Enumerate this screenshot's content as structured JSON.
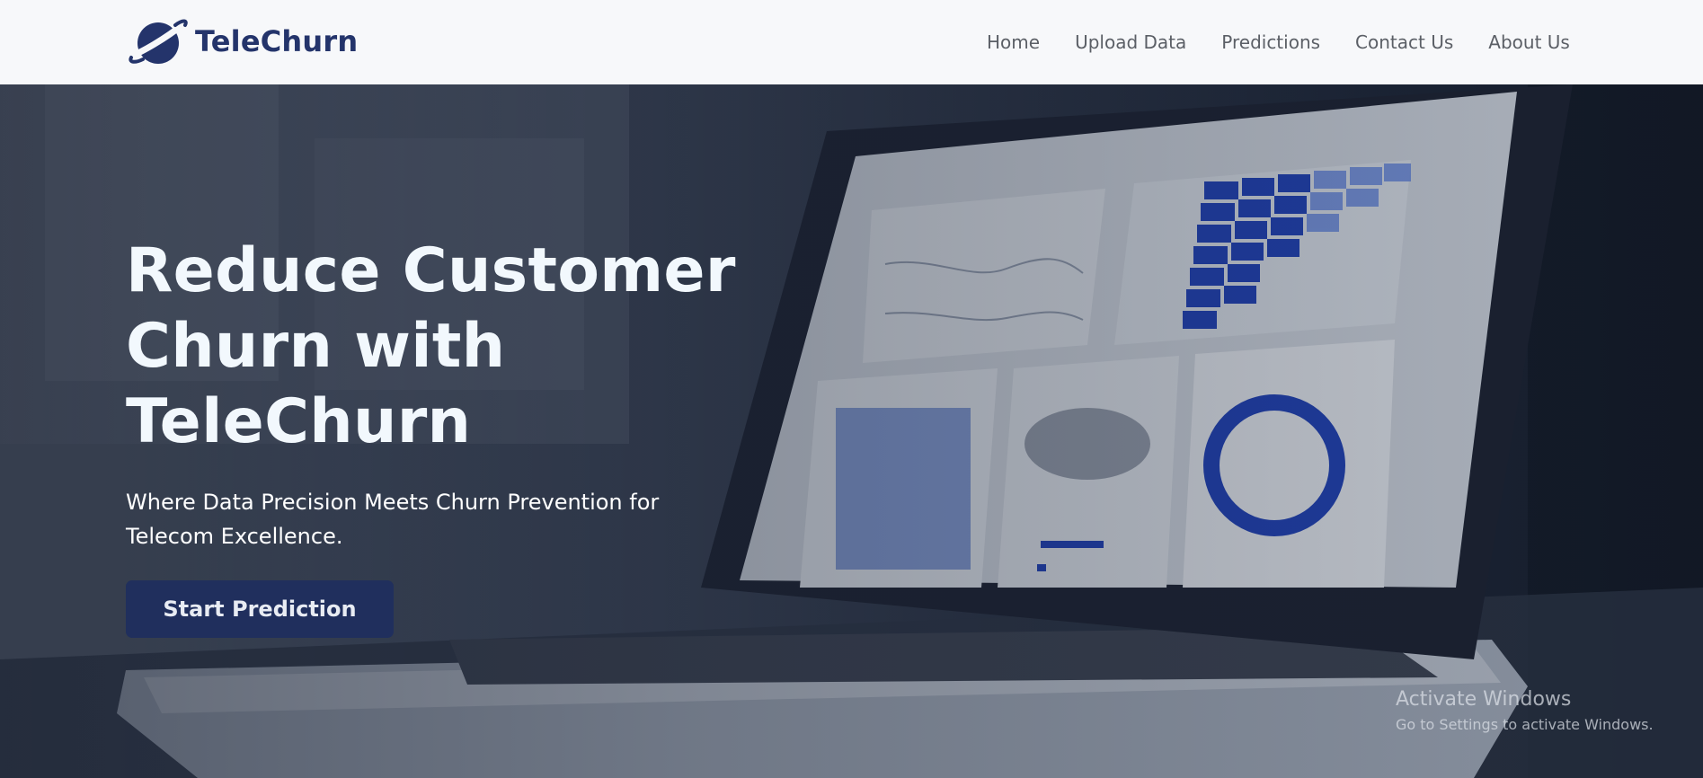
{
  "header": {
    "brand_name": "TeleChurn",
    "logo_icon": "planet-logo-icon",
    "nav": [
      {
        "label": "Home"
      },
      {
        "label": "Upload Data"
      },
      {
        "label": "Predictions"
      },
      {
        "label": "Contact Us"
      },
      {
        "label": "About Us"
      }
    ]
  },
  "hero": {
    "title": "Reduce Customer Churn with TeleChurn",
    "subtitle": "Where Data Precision Meets Churn Prevention for Telecom Excellence.",
    "cta_label": "Start Prediction",
    "background": "laptop-analytics-dashboard-photo"
  },
  "watermark": {
    "title": "Activate Windows",
    "subtitle": "Go to Settings to activate Windows."
  },
  "colors": {
    "brand": "#24346b",
    "button": "#202f5d",
    "header_bg": "#f7f8fa",
    "nav_text": "#5b5f66"
  }
}
